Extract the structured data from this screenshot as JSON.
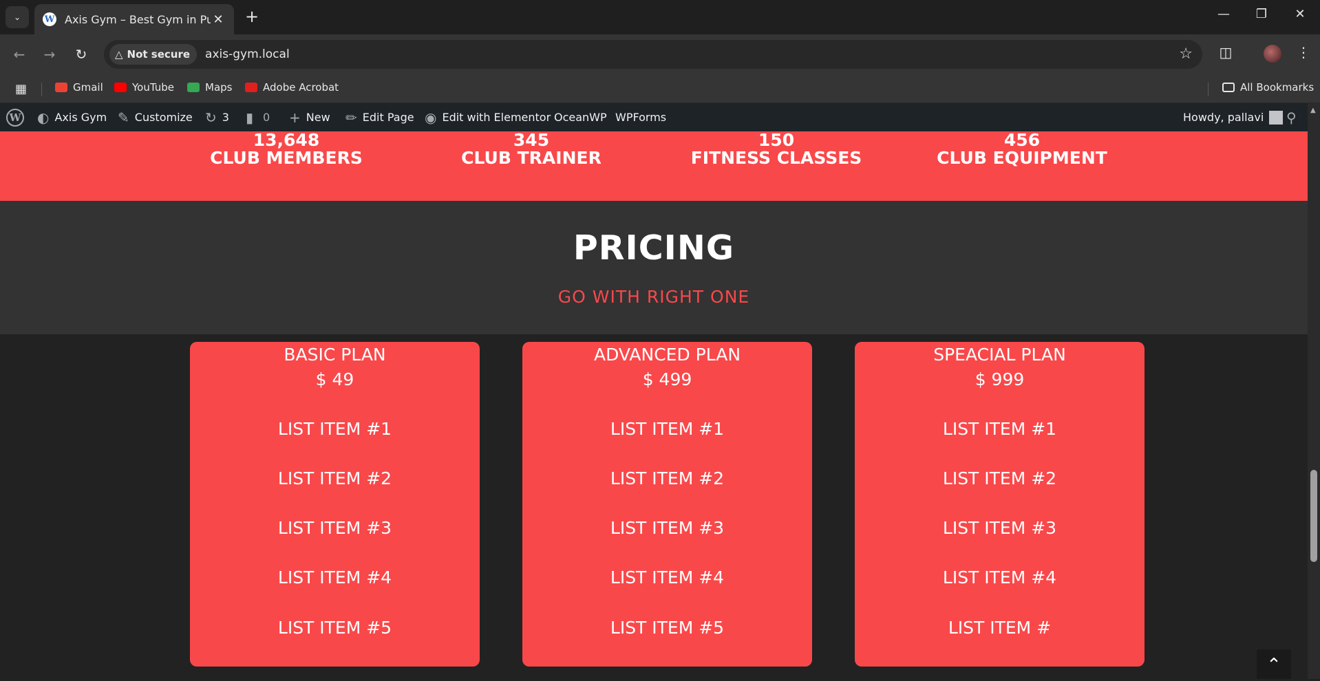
{
  "browser": {
    "tab_title": "Axis Gym – Best Gym in Pune",
    "security_label": "Not secure",
    "url": "axis-gym.local",
    "bookmarks": [
      {
        "label": "Gmail",
        "color": "#ea4335"
      },
      {
        "label": "YouTube",
        "color": "#ff0000"
      },
      {
        "label": "Maps",
        "color": "#34a853"
      },
      {
        "label": "Adobe Acrobat",
        "color": "#e01f1f"
      }
    ],
    "all_bookmarks_label": "All Bookmarks"
  },
  "wp_admin_bar": {
    "site_name": "Axis Gym",
    "customize": "Customize",
    "updates_count": "3",
    "comments_count": "0",
    "new_label": "New",
    "edit_page": "Edit Page",
    "elementor": "Edit with Elementor",
    "oceanwp": "OceanWP",
    "wpforms": "WPForms",
    "howdy": "Howdy, pallavi"
  },
  "stats": [
    {
      "number": "13,648",
      "label": "CLUB MEMBERS"
    },
    {
      "number": "345",
      "label": "CLUB TRAINER"
    },
    {
      "number": "150",
      "label": "FITNESS CLASSES"
    },
    {
      "number": "456",
      "label": "CLUB EQUIPMENT"
    }
  ],
  "pricing": {
    "title": "PRICING",
    "subtitle": "GO WITH RIGHT ONE",
    "plans": [
      {
        "name": "BASIC PLAN",
        "price": "$ 49",
        "items": [
          "LIST ITEM #1",
          "LIST ITEM #2",
          "LIST ITEM #3",
          "LIST ITEM #4",
          "LIST ITEM #5"
        ]
      },
      {
        "name": "ADVANCED PLAN",
        "price": "$ 499",
        "items": [
          "LIST ITEM #1",
          "LIST ITEM #2",
          "LIST ITEM #3",
          "LIST ITEM #4",
          "LIST ITEM #5"
        ]
      },
      {
        "name": "SPEACIAL PLAN",
        "price": "$ 999",
        "items": [
          "LIST ITEM #1",
          "LIST ITEM #2",
          "LIST ITEM #3",
          "LIST ITEM #4",
          "LIST ITEM #"
        ]
      }
    ]
  },
  "colors": {
    "accent": "#f9484a",
    "dark_section": "#333333",
    "page_bg": "#222222",
    "wp_bar": "#1d2327"
  }
}
